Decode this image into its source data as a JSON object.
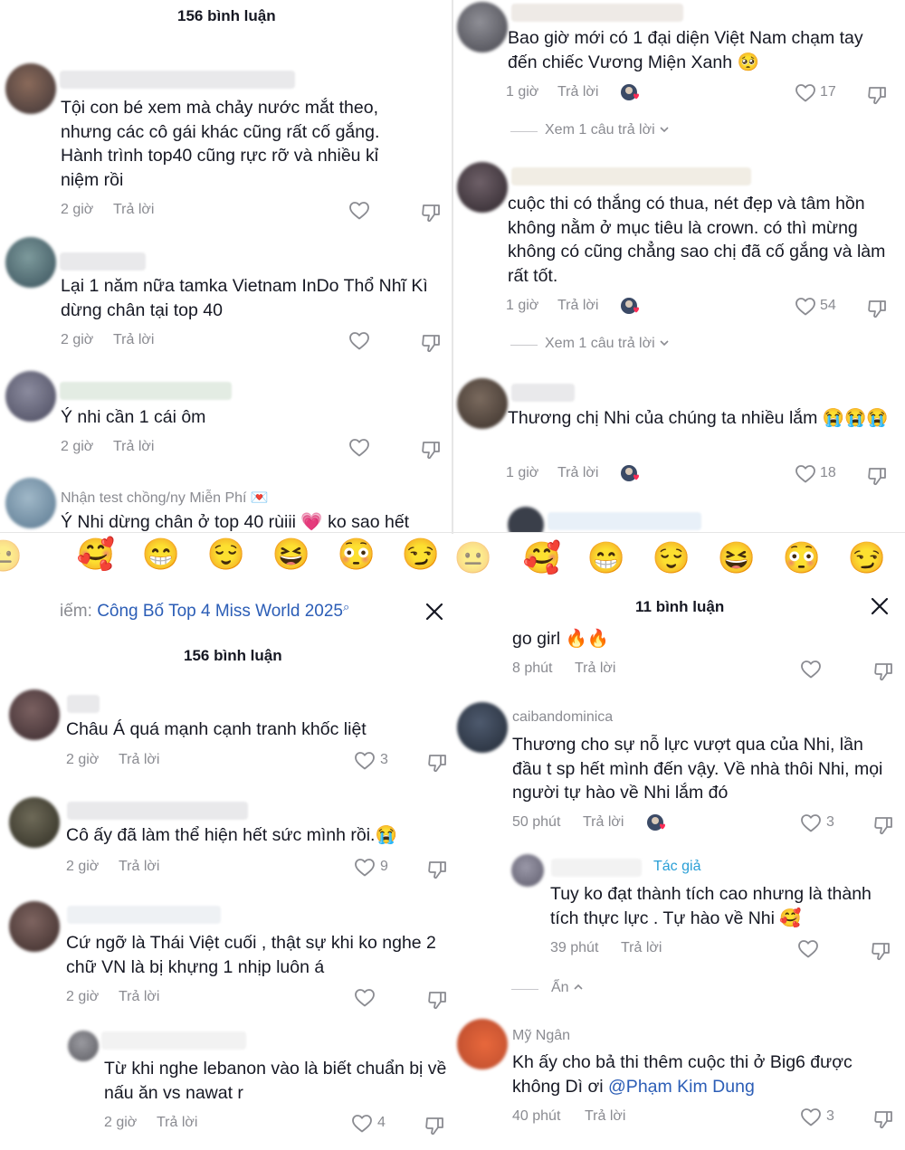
{
  "colors": {
    "text": "#161823",
    "muted": "#8a8b91",
    "link": "#2b5db6",
    "like": "#8a8b91",
    "author": "#2a9fd6"
  },
  "panel_tl": {
    "title": "156 bình luận",
    "comments": [
      {
        "text": "Tội con bé xem mà chảy nước mắt theo, nhưng các cô gái khác cũng rất cố gắng. Hành trình top40 cũng rực rỡ và nhiều kỉ niệm rồi",
        "time": "2 giờ",
        "reply": "Trả lời"
      },
      {
        "text": "Lại 1 năm nữa tamka Vietnam InDo Thổ Nhĩ Kì dừng chân tại top 40",
        "time": "2 giờ",
        "reply": "Trả lời"
      },
      {
        "text": "Ý nhi cần 1 cái ôm",
        "time": "2 giờ",
        "reply": "Trả lời"
      },
      {
        "name": "Nhận test chồng/ny Miễn Phí 💌",
        "text": "Ý Nhi dừng chân ở top 40 rùiii 💗 ko sao hết"
      }
    ]
  },
  "panel_tr": {
    "comments": [
      {
        "text": "Bao giờ mới có 1 đại diện Việt Nam chạm tay đến chiếc Vương Miện Xanh 🥺",
        "time": "1 giờ",
        "reply": "Trả lời",
        "likes": "17",
        "view_replies": "Xem 1 câu trả lời"
      },
      {
        "text": "cuộc thi có thắng có thua, nét đẹp và tâm hồn không nằm ở mục tiêu là crown. có thì mừng không có cũng chẳng sao chị đã cố gắng và làm rất tốt.",
        "time": "1 giờ",
        "reply": "Trả lời",
        "likes": "54",
        "view_replies": "Xem 1 câu trả lời"
      },
      {
        "text": "Thương chị Nhi của chúng ta nhiều lắm 😭😭😭",
        "time": "1 giờ",
        "reply": "Trả lời",
        "likes": "18"
      }
    ]
  },
  "emojis": [
    "🥰",
    "😁",
    "😌",
    "😆",
    "😳",
    "😏"
  ],
  "panel_bl": {
    "search_label": "iếm:",
    "search_term": "Công Bố Top 4 Miss World 2025",
    "title": "156 bình luận",
    "comments": [
      {
        "text": "Châu Á quá mạnh cạnh tranh khốc liệt",
        "time": "2 giờ",
        "reply": "Trả lời",
        "likes": "3"
      },
      {
        "text": "Cô ấy đã làm thể hiện hết sức mình rồi.😭",
        "time": "2 giờ",
        "reply": "Trả lời",
        "likes": "9"
      },
      {
        "text": "Cứ ngỡ là Thái Việt cuối , thật sự khi ko nghe 2 chữ VN là bị khựng 1 nhịp luôn á",
        "time": "2 giờ",
        "reply": "Trả lời"
      },
      {
        "text": "Từ khi nghe lebanon vào là biết chuẩn bị về nấu ăn vs nawat r",
        "time": "2 giờ",
        "reply": "Trả lời",
        "likes": "4"
      }
    ]
  },
  "panel_br": {
    "title": "11 bình luận",
    "comments": [
      {
        "text": "go girl 🔥🔥",
        "time": "8 phút",
        "reply": "Trả lời"
      },
      {
        "name": "caibandominica",
        "text": "Thương cho sự nỗ lực vượt qua của Nhi, lần đầu t sp hết mình đến vậy. Về nhà thôi Nhi, mọi người tự hào về Nhi lắm đó",
        "time": "50 phút",
        "reply": "Trả lời",
        "likes": "3"
      },
      {
        "author_tag": "Tác giả",
        "text": "Tuy ko đạt thành tích cao nhưng là thành tích thực lực . Tự hào về Nhi 🥰",
        "time": "39 phút",
        "reply": "Trả lời",
        "hide": "Ẩn"
      },
      {
        "name": "Mỹ Ngân",
        "text_pre": "Kh ấy cho bả thi thêm cuộc thi ở Big6 được không Dì ơi ",
        "mention": "@Phạm Kim Dung",
        "time": "40 phút",
        "reply": "Trả lời",
        "likes": "3"
      }
    ]
  }
}
